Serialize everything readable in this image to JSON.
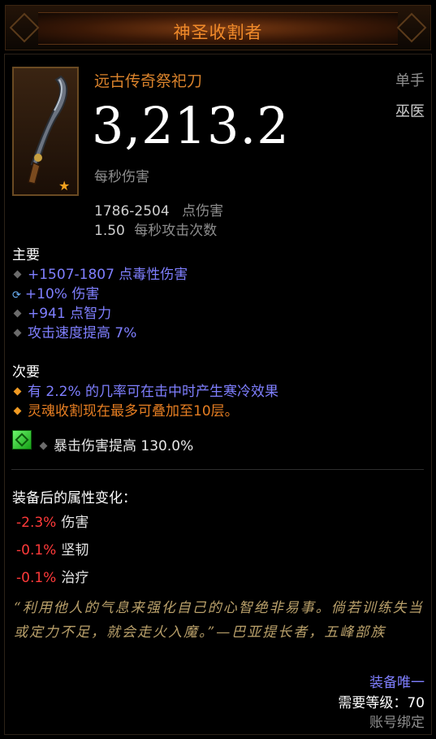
{
  "header": {
    "title": "神圣收割者"
  },
  "item": {
    "name": "远古传奇祭祀刀",
    "slot": "单手",
    "class": "巫医",
    "dps": "3,213.2",
    "dps_label": "每秒伤害",
    "damage_range": "1786-2504",
    "damage_label": "点伤害",
    "attacks_per_second": "1.50",
    "aps_label": "每秒攻击次数",
    "star_icon": "star-icon"
  },
  "primary": {
    "label": "主要",
    "affixes": [
      {
        "text": "+1507-1807 点毒性伤害",
        "icon": "diamond-bullet-icon"
      },
      {
        "text": "+10% 伤害",
        "icon": "enchant-reroll-icon"
      },
      {
        "text": "+941 点智力",
        "icon": "diamond-bullet-icon"
      },
      {
        "text": "攻击速度提高 7%",
        "icon": "diamond-bullet-icon"
      }
    ]
  },
  "secondary": {
    "label": "次要",
    "affixes": [
      {
        "text": "有 2.2% 的几率可在击中时产生寒冷效果",
        "icon": "orange-diamond-bullet-icon"
      },
      {
        "text": "灵魂收割现在最多可叠加至10层。",
        "icon": "orange-diamond-bullet-icon"
      }
    ]
  },
  "gem": {
    "text": "暴击伤害提高 130.0%",
    "icon": "emerald-gem-icon"
  },
  "changes": {
    "title": "装备后的属性变化：",
    "rows": [
      {
        "delta": "-2.3%",
        "label": "伤害"
      },
      {
        "delta": "-0.1%",
        "label": "坚韧"
      },
      {
        "delta": "-0.1%",
        "label": "治疗"
      }
    ]
  },
  "flavor": "“利用他人的气息来强化自己的心智绝非易事。倘若训练失当或定力不足，就会走火入魔。”—巴亚提长者，五峰部族",
  "footer": {
    "unique": "装备唯一",
    "required_level": "需要等级：70",
    "bound": "账号绑定"
  },
  "colors": {
    "legendary": "#d9822b",
    "magic": "#7f7fff",
    "negative": "#ff3a3a",
    "flavor": "#b9a06a"
  }
}
